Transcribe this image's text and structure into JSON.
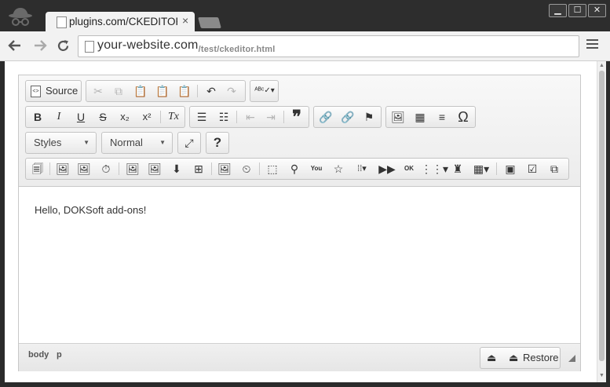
{
  "browser": {
    "tab_title": "plugins.com/CKEDITOR",
    "tab_close": "×",
    "url_host": "your-website.com",
    "url_path": "/test/ckeditor.html",
    "window_buttons": [
      "▁",
      "☐",
      "✕"
    ]
  },
  "toolbar": {
    "source_label": "Source",
    "styles_label": "Styles",
    "format_label": "Normal",
    "help_label": "?",
    "bold": "B",
    "italic": "I",
    "underline": "U",
    "strike": "S",
    "subscript": "x₂",
    "superscript": "x²",
    "remove_format": "Tx",
    "blockquote": "❞",
    "special_char": "Ω"
  },
  "content": {
    "text": "Hello, DOKSoft add-ons!"
  },
  "footer": {
    "path": [
      "body",
      "p"
    ],
    "restore_label": "Restore"
  }
}
